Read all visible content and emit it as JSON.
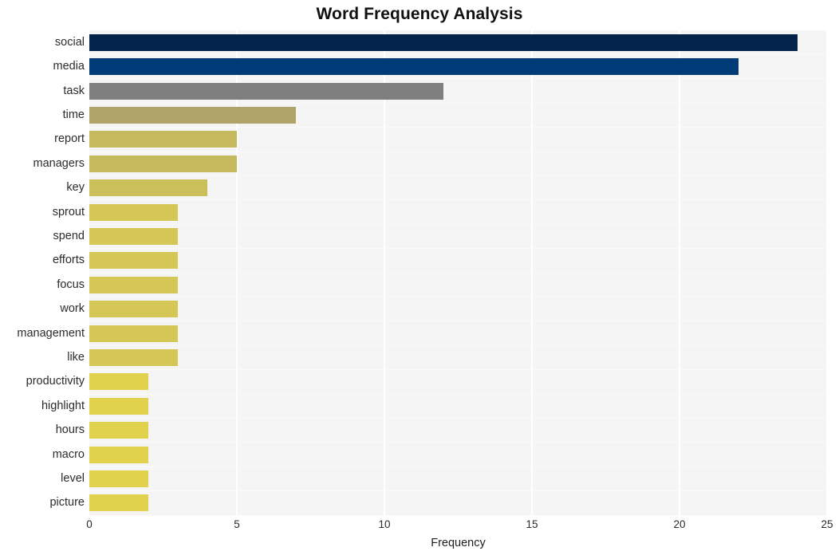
{
  "chart_data": {
    "type": "bar",
    "orientation": "horizontal",
    "title": "Word Frequency Analysis",
    "xlabel": "Frequency",
    "ylabel": "",
    "xlim": [
      0,
      25
    ],
    "xticks": [
      0,
      5,
      10,
      15,
      20,
      25
    ],
    "xtick_labels": [
      "0",
      "5",
      "10",
      "15",
      "20",
      "25"
    ],
    "grid": true,
    "grid_axis": "x",
    "legend": "none",
    "categories": [
      "social",
      "media",
      "task",
      "time",
      "report",
      "managers",
      "key",
      "sprout",
      "spend",
      "efforts",
      "focus",
      "work",
      "management",
      "like",
      "productivity",
      "highlight",
      "hours",
      "macro",
      "level",
      "picture"
    ],
    "values": [
      24,
      22,
      12,
      7,
      5,
      5,
      4,
      3,
      3,
      3,
      3,
      3,
      3,
      3,
      2,
      2,
      2,
      2,
      2,
      2
    ],
    "bar_colors": [
      "#04234a",
      "#003a77",
      "#7f7f7f",
      "#b0a469",
      "#c6ba5e",
      "#c6ba5e",
      "#cbbf5a",
      "#d4c755",
      "#d4c755",
      "#d4c755",
      "#d4c755",
      "#d4c755",
      "#d4c755",
      "#d4c755",
      "#e0d24c",
      "#e0d24c",
      "#e0d24c",
      "#e0d24c",
      "#e0d24c",
      "#e0d24c"
    ],
    "plot_background": "#f5f5f6",
    "figure_background": "#ffffff",
    "gridline_color": "#ffffff"
  }
}
